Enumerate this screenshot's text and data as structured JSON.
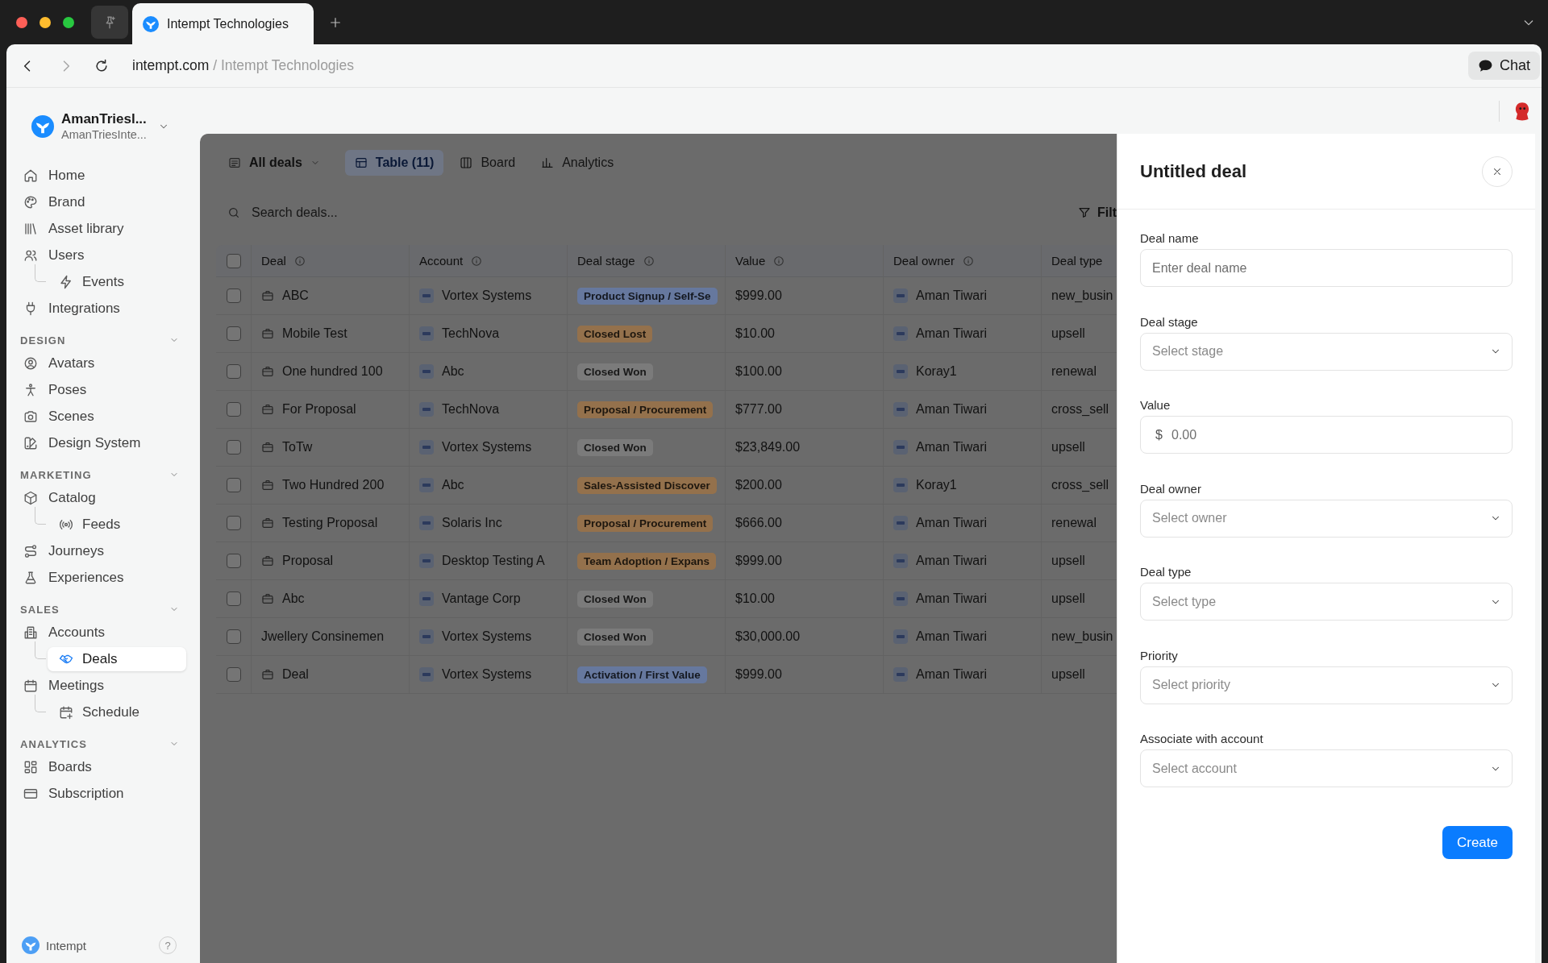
{
  "browser": {
    "nav": {
      "back_disabled": false,
      "forward_disabled": true
    },
    "tabs": [
      {
        "title": "Intempt Technologies",
        "selected": true
      }
    ],
    "address": {
      "domain": "intempt.com",
      "page": "/ Intempt Technologies"
    },
    "chat_button": "Chat"
  },
  "sidebar": {
    "workspace": {
      "name": "AmanTriesl...",
      "subtitle": "AmanTriesInte..."
    },
    "items": [
      {
        "label": "Home",
        "selected": false
      },
      {
        "label": "Brand",
        "selected": false
      },
      {
        "label": "Asset library",
        "selected": false
      },
      {
        "label": "Users",
        "selected": false,
        "children": [
          {
            "label": "Events",
            "selected": false
          }
        ]
      },
      {
        "label": "Integrations",
        "selected": false
      }
    ],
    "sections": [
      {
        "title": "DESIGN",
        "expanded": true,
        "items": [
          {
            "label": "Avatars",
            "selected": false
          },
          {
            "label": "Poses",
            "selected": false
          },
          {
            "label": "Scenes",
            "selected": false
          },
          {
            "label": "Design System",
            "selected": false
          }
        ]
      },
      {
        "title": "MARKETING",
        "expanded": true,
        "items": [
          {
            "label": "Catalog",
            "selected": false,
            "children": [
              {
                "label": "Feeds",
                "selected": false
              }
            ]
          },
          {
            "label": "Journeys",
            "selected": false
          },
          {
            "label": "Experiences",
            "selected": false
          }
        ]
      },
      {
        "title": "SALES",
        "expanded": true,
        "items": [
          {
            "label": "Accounts",
            "selected": false,
            "children": [
              {
                "label": "Deals",
                "selected": true
              }
            ]
          },
          {
            "label": "Meetings",
            "selected": false,
            "children": [
              {
                "label": "Schedule",
                "selected": false
              }
            ]
          }
        ]
      },
      {
        "title": "ANALYTICS",
        "expanded": true,
        "items": [
          {
            "label": "Boards",
            "selected": false
          },
          {
            "label": "Subscription",
            "selected": false
          }
        ]
      }
    ],
    "footer": {
      "brand": "Intempt",
      "help": "?"
    }
  },
  "deals_view": {
    "view_menu": "All deals",
    "tabs": [
      {
        "label": "Table (11)",
        "selected": true
      },
      {
        "label": "Board",
        "selected": false
      },
      {
        "label": "Analytics",
        "selected": false
      }
    ],
    "search": {
      "placeholder": "Search deals..."
    },
    "filter_button": "Filt",
    "table": {
      "header_checked": false,
      "columns": [
        "Deal",
        "Account",
        "Deal stage",
        "Value",
        "Deal owner",
        "Deal type"
      ],
      "rows": [
        {
          "checked": false,
          "kind": "iconed",
          "deal": "ABC",
          "account": "Vortex Systems",
          "stage": {
            "label": "Product Signup / Self-Se",
            "color": "#66789e"
          },
          "value": "$999.00",
          "owner": "Aman Tiwari",
          "type": "new_busin"
        },
        {
          "checked": false,
          "kind": "iconed",
          "deal": "Mobile Test",
          "account": "TechNova",
          "stage": {
            "label": "Closed Lost",
            "color": "#94714c"
          },
          "value": "$10.00",
          "owner": "Aman Tiwari",
          "type": "upsell"
        },
        {
          "checked": false,
          "kind": "iconed",
          "deal": "One hundred 100",
          "account": "Abc",
          "stage": {
            "label": "Closed Won",
            "color": "#7b7b7b"
          },
          "value": "$100.00",
          "owner": "Koray1",
          "type": "renewal"
        },
        {
          "checked": false,
          "kind": "iconed",
          "deal": "For Proposal",
          "account": "TechNova",
          "stage": {
            "label": "Proposal / Procurement",
            "color": "#94714c"
          },
          "value": "$777.00",
          "owner": "Aman Tiwari",
          "type": "cross_sell"
        },
        {
          "checked": false,
          "kind": "iconed",
          "deal": "ToTw",
          "account": "Vortex Systems",
          "stage": {
            "label": "Closed Won",
            "color": "#7b7b7b"
          },
          "value": "$23,849.00",
          "owner": "Aman Tiwari",
          "type": "upsell"
        },
        {
          "checked": false,
          "kind": "iconed",
          "deal": "Two Hundred 200",
          "account": "Abc",
          "stage": {
            "label": "Sales-Assisted Discover",
            "color": "#94714c"
          },
          "value": "$200.00",
          "owner": "Koray1",
          "type": "cross_sell"
        },
        {
          "checked": false,
          "kind": "iconed",
          "deal": "Testing Proposal",
          "account": "Solaris Inc",
          "stage": {
            "label": "Proposal / Procurement",
            "color": "#94714c"
          },
          "value": "$666.00",
          "owner": "Aman Tiwari",
          "type": "renewal"
        },
        {
          "checked": false,
          "kind": "iconed",
          "deal": "Proposal",
          "account": "Desktop Testing A",
          "stage": {
            "label": "Team Adoption / Expans",
            "color": "#94714c"
          },
          "value": "$999.00",
          "owner": "Aman Tiwari",
          "type": "upsell"
        },
        {
          "checked": false,
          "kind": "iconed",
          "deal": "Abc",
          "account": "Vantage Corp",
          "stage": {
            "label": "Closed Won",
            "color": "#7b7b7b"
          },
          "value": "$10.00",
          "owner": "Aman Tiwari",
          "type": "upsell"
        },
        {
          "checked": false,
          "kind": "plain",
          "deal": "Jwellery Consinemen",
          "account": "Vortex Systems",
          "stage": {
            "label": "Closed Won",
            "color": "#7b7b7b"
          },
          "value": "$30,000.00",
          "owner": "Aman Tiwari",
          "type": "new_busin"
        },
        {
          "checked": false,
          "kind": "iconed",
          "deal": "Deal",
          "account": "Vortex Systems",
          "stage": {
            "label": "Activation / First Value",
            "color": "#66789e"
          },
          "value": "$999.00",
          "owner": "Aman Tiwari",
          "type": "upsell"
        }
      ]
    }
  },
  "drawer": {
    "title": "Untitled deal",
    "fields": [
      {
        "kind": "text",
        "label": "Deal name",
        "placeholder": "Enter deal name"
      },
      {
        "kind": "select",
        "label": "Deal stage",
        "placeholder": "Select stage"
      },
      {
        "kind": "currency",
        "label": "Value",
        "prefix": "$",
        "placeholder": "0.00"
      },
      {
        "kind": "select",
        "label": "Deal owner",
        "placeholder": "Select owner"
      },
      {
        "kind": "select",
        "label": "Deal type",
        "placeholder": "Select type"
      },
      {
        "kind": "select",
        "label": "Priority",
        "placeholder": "Select priority"
      },
      {
        "kind": "select",
        "label": "Associate with account",
        "placeholder": "Select account"
      }
    ],
    "submit": "Create"
  }
}
